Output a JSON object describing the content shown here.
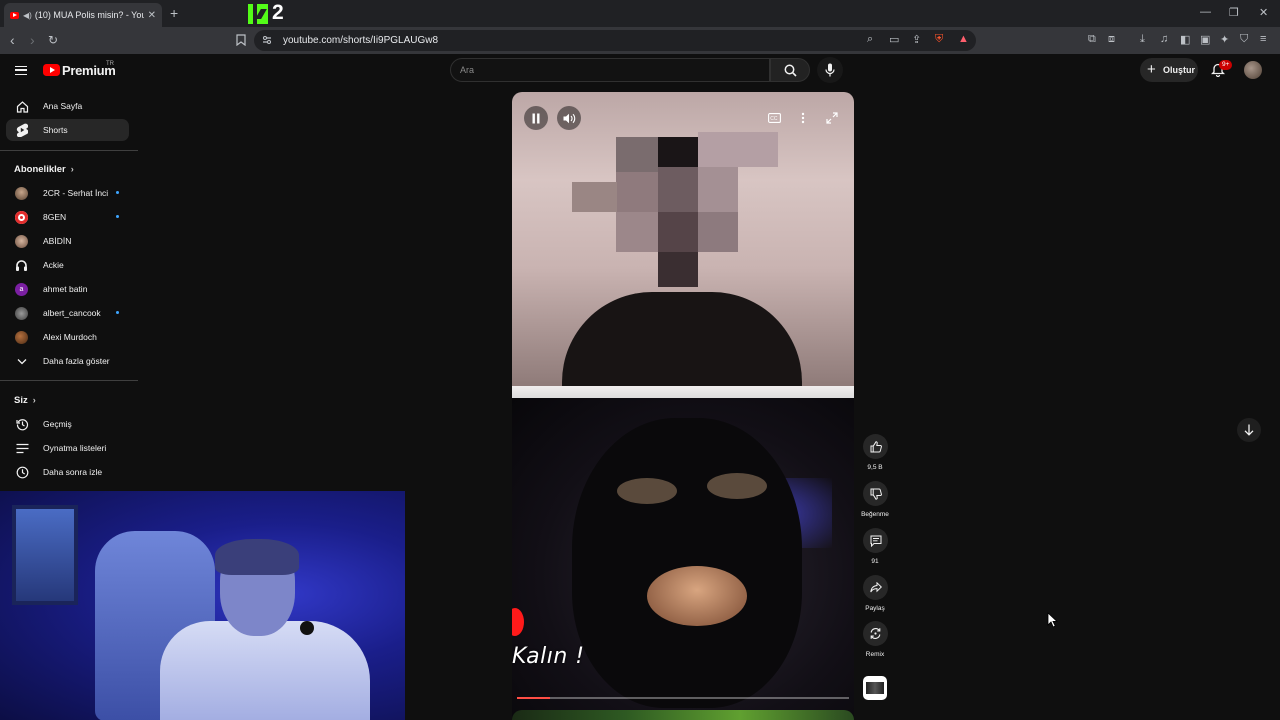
{
  "browser": {
    "tab_title": "(10) MUA Polis misin? - YouTu",
    "kick_number": "2",
    "url": "youtube.com/shorts/Ii9PGLAUGw8"
  },
  "header": {
    "brand": "Premium",
    "country": "TR",
    "search_placeholder": "Ara",
    "create_label": "Oluştur",
    "notification_count": "9+"
  },
  "sidebar": {
    "main": [
      {
        "label": "Ana Sayfa",
        "icon": "home-icon"
      },
      {
        "label": "Shorts",
        "icon": "shorts-icon",
        "active": true
      }
    ],
    "subscriptions_title": "Abonelikler",
    "subscriptions": [
      {
        "label": "2CR - Serhat İnci",
        "live": true
      },
      {
        "label": "8GEN",
        "live": true
      },
      {
        "label": "ABİDİN",
        "live": false
      },
      {
        "label": "Ackie",
        "live": false
      },
      {
        "label": "ahmet batin",
        "live": false,
        "initial": "a"
      },
      {
        "label": "albert_cancook",
        "live": true
      },
      {
        "label": "Alexi Murdoch",
        "live": false
      }
    ],
    "show_more": "Daha fazla göster",
    "you_title": "Siz",
    "you_items": [
      {
        "label": "Geçmiş",
        "icon": "history-icon"
      },
      {
        "label": "Oynatma listeleri",
        "icon": "playlists-icon"
      },
      {
        "label": "Daha sonra izle",
        "icon": "watch-later-icon"
      }
    ]
  },
  "short": {
    "overlay_text": "Kalın !",
    "progress": 0.1
  },
  "actions": {
    "like_count": "9,5 B",
    "dislike_label": "Beğenme",
    "comment_count": "91",
    "share_label": "Paylaş",
    "remix_label": "Remix"
  },
  "colors": {
    "background": "#0f0f0f",
    "brand_red": "#ff0000",
    "live_dot": "#3ea6ff",
    "kick_green": "#53fc18"
  }
}
